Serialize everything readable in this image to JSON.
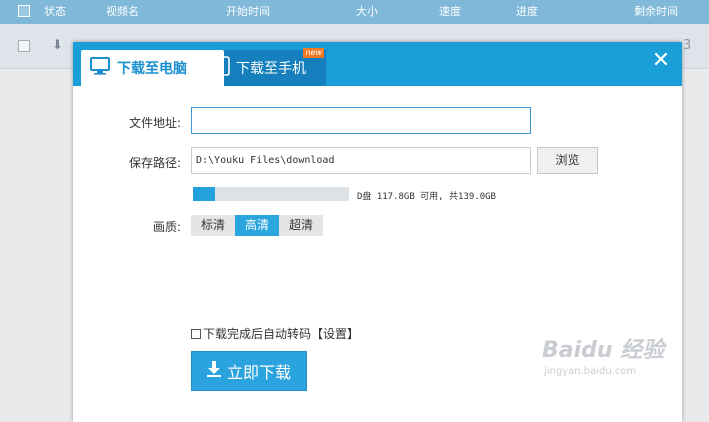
{
  "table": {
    "columns": [
      "状态",
      "视频名",
      "开始时间",
      "大小",
      "速度",
      "进度",
      "剩余时间"
    ],
    "row_tail_number": "3"
  },
  "dialog": {
    "tabs": [
      {
        "label": "下载至电脑",
        "icon": "monitor-icon",
        "active": true
      },
      {
        "label": "下载至手机",
        "icon": "phone-icon",
        "badge": "new",
        "active": false
      }
    ],
    "close_label": "✕",
    "url_label": "文件地址:",
    "url_value": "",
    "path_label": "保存路径:",
    "path_value": "D:\\Youku Files\\download",
    "browse_label": "浏览",
    "disk": {
      "used_fraction": 0.14,
      "text": "D盘 117.8GB 可用, 共139.0GB"
    },
    "quality_label": "画质:",
    "quality_options": [
      "标清",
      "高清",
      "超清"
    ],
    "quality_selected": "高清",
    "auto_transcode_label": "下载完成后自动转码",
    "settings_link": "【设置】",
    "download_button": "立即下载"
  },
  "watermark": {
    "line1": "Baidu 经验",
    "line2": "jingyan.baidu.com"
  },
  "colors": {
    "accent": "#199ed8",
    "tab_inactive": "#1580bd",
    "badge": "#ee7b23",
    "button": "#2aa3de"
  }
}
